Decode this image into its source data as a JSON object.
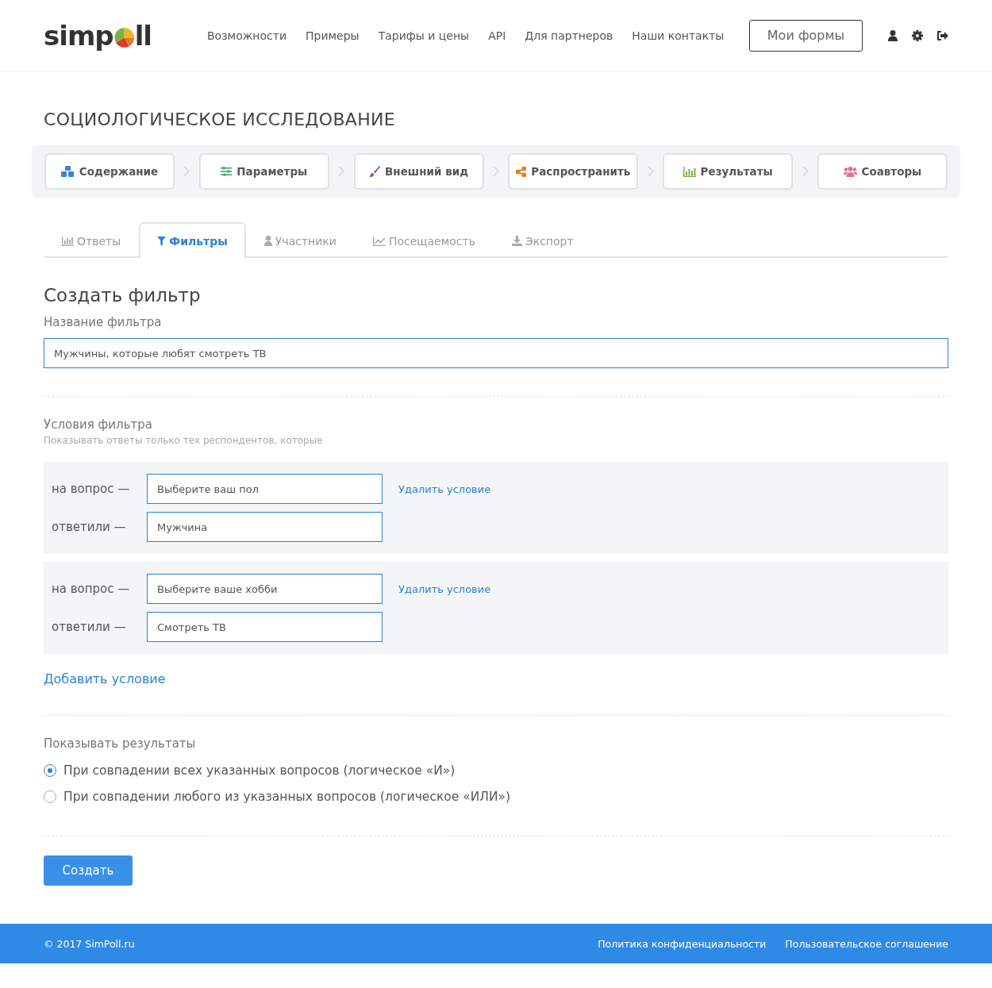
{
  "header": {
    "logo": {
      "before": "simp",
      "after": "ll"
    },
    "nav": [
      "Возможности",
      "Примеры",
      "Тарифы и цены",
      "API",
      "Для партнеров",
      "Наши контакты"
    ],
    "my_forms_button": "Мои формы"
  },
  "page_title": "СОЦИОЛОГИЧЕСКОЕ ИССЛЕДОВАНИЕ",
  "steps": [
    {
      "label": "Содержание"
    },
    {
      "label": "Параметры"
    },
    {
      "label": "Внешний вид"
    },
    {
      "label": "Распространить"
    },
    {
      "label": "Результаты"
    },
    {
      "label": "Соавторы"
    }
  ],
  "tabs": [
    {
      "label": "Ответы",
      "selected": false
    },
    {
      "label": "Фильтры",
      "selected": true
    },
    {
      "label": "Участники",
      "selected": false
    },
    {
      "label": "Посещаемость",
      "selected": false
    },
    {
      "label": "Экспорт",
      "selected": false
    }
  ],
  "form": {
    "heading": "Создать фильтр",
    "name_label": "Название фильтра",
    "name_value": "Мужчины, которые любят смотреть ТВ",
    "conditions_label": "Условия фильтра",
    "conditions_hint": "Показывать ответы только тех респондентов, которые",
    "conditions": [
      {
        "question_label": "на вопрос —",
        "question": "Выберите ваш пол",
        "answer_label": "ответили —",
        "answer": "Мужчина",
        "delete": "Удалить условие"
      },
      {
        "question_label": "на вопрос —",
        "question": "Выберите ваше хобби",
        "answer_label": "ответили —",
        "answer": "Смотреть ТВ",
        "delete": "Удалить условие"
      }
    ],
    "add_condition": "Добавить условие",
    "results_label": "Показывать результаты",
    "options": [
      {
        "label": "При совпадении всех указанных вопросов (логическое «И»)",
        "selected": true
      },
      {
        "label": "При совпадении любого из указанных вопросов (логическое «ИЛИ»)",
        "selected": false
      }
    ],
    "submit": "Создать"
  },
  "footer": {
    "copyright": "© 2017 SimPoll.ru",
    "links": [
      "Политика конфиденциальности",
      "Пользовательское соглашение"
    ]
  }
}
